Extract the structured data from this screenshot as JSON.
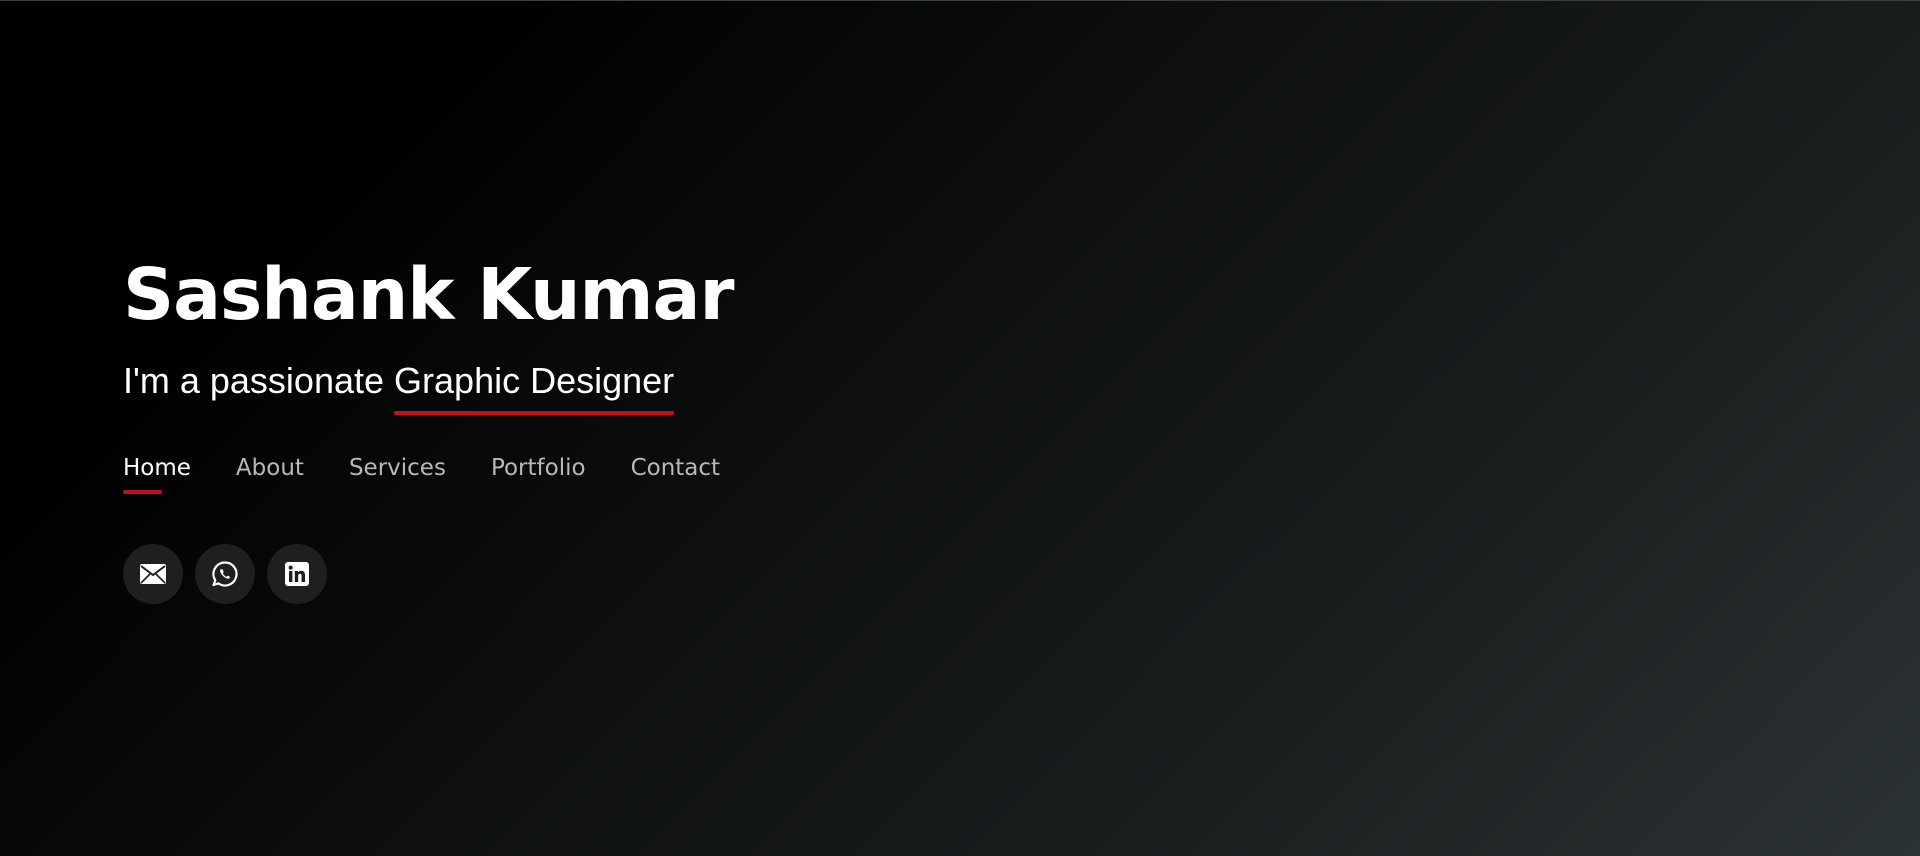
{
  "hero": {
    "name": "Sashank Kumar",
    "tagline_prefix": "I'm a passionate ",
    "tagline_role": "Graphic Designer"
  },
  "nav": {
    "items": [
      {
        "label": "Home",
        "active": true
      },
      {
        "label": "About",
        "active": false
      },
      {
        "label": "Services",
        "active": false
      },
      {
        "label": "Portfolio",
        "active": false
      },
      {
        "label": "Contact",
        "active": false
      }
    ]
  },
  "social": {
    "icons": [
      "envelope-icon",
      "whatsapp-icon",
      "linkedin-icon"
    ]
  },
  "colors": {
    "accent": "#c4101a",
    "text": "#ffffff",
    "nav_inactive": "#b8b8b8",
    "icon_bg": "#1f1f1f"
  }
}
